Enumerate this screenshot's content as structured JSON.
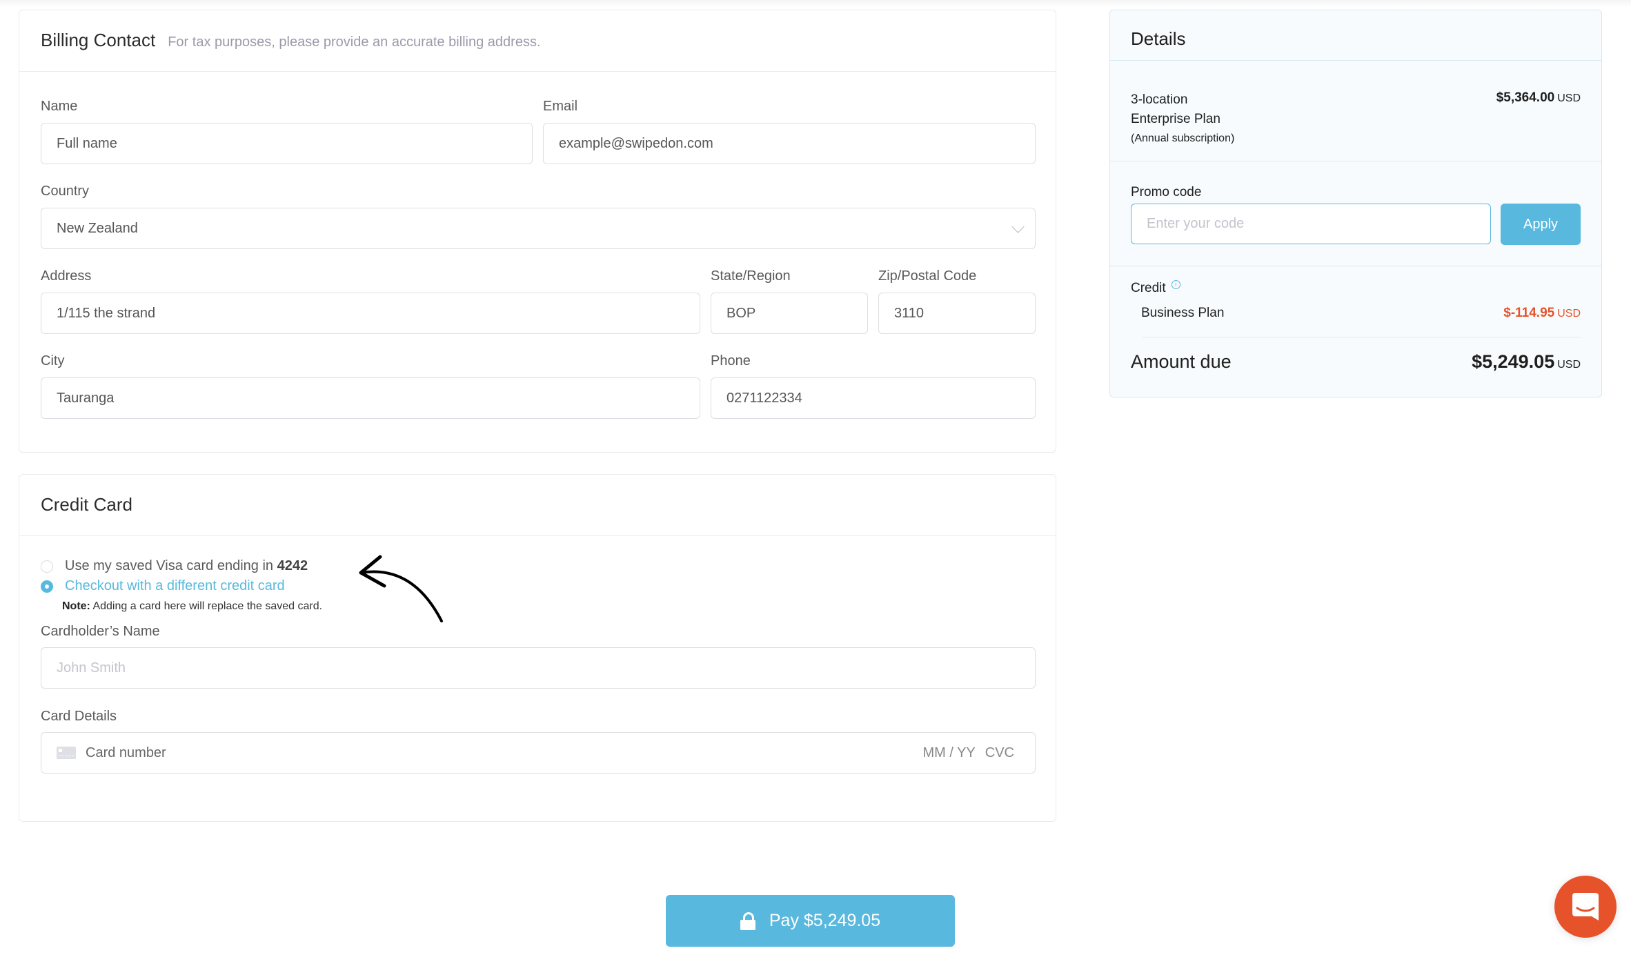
{
  "billing": {
    "title": "Billing Contact",
    "subtitle": "For tax purposes, please provide an accurate billing address.",
    "name": {
      "label": "Name",
      "value": "Full name"
    },
    "email": {
      "label": "Email",
      "value": "example@swipedon.com"
    },
    "country": {
      "label": "Country",
      "value": "New Zealand"
    },
    "address": {
      "label": "Address",
      "value": "1/115 the strand"
    },
    "state": {
      "label": "State/Region",
      "value": "BOP"
    },
    "zip": {
      "label": "Zip/Postal Code",
      "value": "3110"
    },
    "city": {
      "label": "City",
      "value": "Tauranga"
    },
    "phone": {
      "label": "Phone",
      "value": "0271122334"
    }
  },
  "credit_card": {
    "title": "Credit Card",
    "saved_option": {
      "label": "Use my saved Visa card ending in",
      "last4": "4242",
      "selected": false
    },
    "new_option": {
      "label": "Checkout with a different credit card",
      "selected": true
    },
    "note_bold": "Note:",
    "note_text": " Adding a card here will replace the saved card.",
    "cardholder": {
      "label": "Cardholder’s Name",
      "placeholder": "John Smith"
    },
    "card_details": {
      "label": "Card Details",
      "number_placeholder": "Card number",
      "expiry_placeholder": "MM / YY",
      "cvc_placeholder": "CVC"
    }
  },
  "details": {
    "title": "Details",
    "plan_line1": "3-location",
    "plan_line2": "Enterprise Plan",
    "plan_line3": "(Annual subscription)",
    "plan_price": "$5,364.00",
    "currency": "USD",
    "promo_label": "Promo code",
    "promo_placeholder": "Enter your code",
    "apply_label": "Apply",
    "credit_label": "Credit",
    "credit_item": "Business Plan",
    "credit_amount": "$-114.95",
    "amount_due_label": "Amount due",
    "amount_due": "$5,249.05"
  },
  "pay_button": {
    "label": "Pay $5,249.05"
  },
  "colors": {
    "accent": "#58b8dd",
    "negative": "#e6522a",
    "chat": "#e6522a"
  }
}
